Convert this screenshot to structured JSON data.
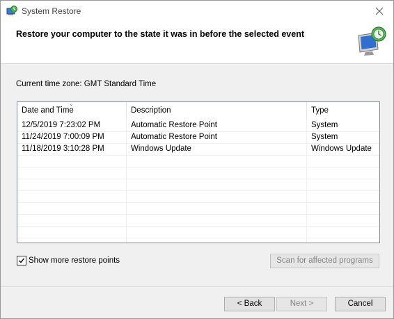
{
  "window": {
    "title": "System Restore"
  },
  "header": {
    "headline": "Restore your computer to the state it was in before the selected event"
  },
  "timezone": {
    "label": "Current time zone: GMT Standard Time"
  },
  "table": {
    "columns": [
      "Date and Time",
      "Description",
      "Type"
    ],
    "rows": [
      [
        "12/5/2019 7:23:02 PM",
        "Automatic Restore Point",
        "System"
      ],
      [
        "11/24/2019 7:00:09 PM",
        "Automatic Restore Point",
        "System"
      ],
      [
        "11/18/2019 3:10:28 PM",
        "Windows Update",
        "Windows Update"
      ]
    ]
  },
  "options": {
    "show_more_label": "Show more restore points",
    "show_more_checked": true
  },
  "buttons": {
    "scan": "Scan for affected programs",
    "back": "< Back",
    "next": "Next >",
    "cancel": "Cancel"
  },
  "icons": {
    "app": "system-restore-icon",
    "close": "close-icon",
    "hero": "restore-computer-icon"
  }
}
